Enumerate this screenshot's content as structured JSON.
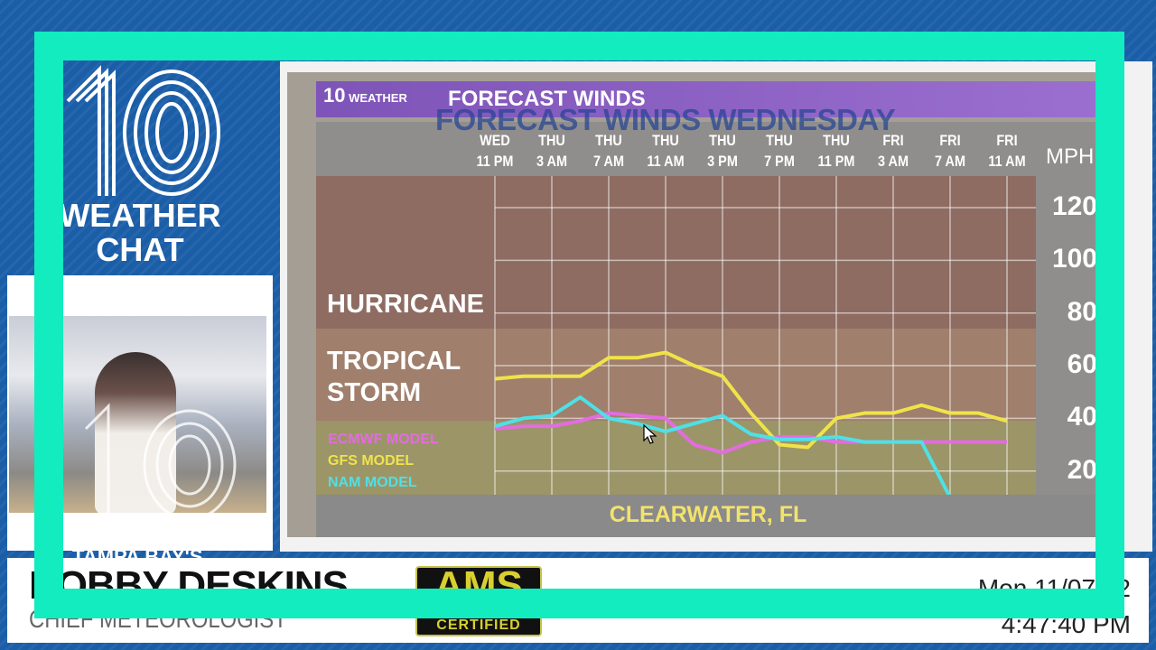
{
  "left": {
    "logo": "10",
    "title_line1": "WEATHER",
    "title_line2": "CHAT"
  },
  "graphic": {
    "brand": "WEATHER",
    "title": "FORECAST WINDS",
    "overlay_title": "FORECAST WINDS WEDNESDAY",
    "location": "CLEARWATER, FL",
    "categories": [
      "HURRICANE",
      "TROPICAL STORM"
    ],
    "category_label_lines": [
      [
        "HURRICANE"
      ],
      [
        "TROPICAL",
        "STORM"
      ]
    ]
  },
  "chart_data": {
    "type": "line",
    "title": "FORECAST WINDS",
    "ylabel": "MPH",
    "ylim": [
      11,
      132
    ],
    "yticks": [
      20,
      40,
      60,
      80,
      100,
      120
    ],
    "xtick_labels": [
      [
        "WED",
        "11 PM"
      ],
      [
        "THU",
        "3 AM"
      ],
      [
        "THU",
        "7 AM"
      ],
      [
        "THU",
        "11 AM"
      ],
      [
        "THU",
        "3 PM"
      ],
      [
        "THU",
        "7 PM"
      ],
      [
        "THU",
        "11 PM"
      ],
      [
        "FRI",
        "3 AM"
      ],
      [
        "FRI",
        "7 AM"
      ],
      [
        "FRI",
        "11 AM"
      ]
    ],
    "x": [
      "Wed 11 PM",
      "Thu 1 AM",
      "Thu 3 AM",
      "Thu 5 AM",
      "Thu 7 AM",
      "Thu 9 AM",
      "Thu 11 AM",
      "Thu 1 PM",
      "Thu 3 PM",
      "Thu 5 PM",
      "Thu 7 PM",
      "Thu 9 PM",
      "Thu 11 PM",
      "Fri 1 AM",
      "Fri 3 AM",
      "Fri 5 AM",
      "Fri 7 AM",
      "Fri 9 AM",
      "Fri 11 AM"
    ],
    "bands": [
      {
        "name": "HURRICANE",
        "from": 74,
        "to": 132,
        "color": "#8e6c62"
      },
      {
        "name": "TROPICAL STORM",
        "from": 39,
        "to": 74,
        "color": "#a07f6c"
      },
      {
        "name": "",
        "from": 11,
        "to": 39,
        "color": "#9c9568"
      }
    ],
    "grid": true,
    "legend": "bottom-left",
    "series": [
      {
        "name": "ECMWF MODEL",
        "color": "#e36ce0",
        "values": [
          36,
          37,
          37,
          39,
          42,
          41,
          40,
          30,
          27,
          31,
          33,
          33,
          31,
          31,
          31,
          31,
          31,
          31,
          31
        ]
      },
      {
        "name": "GFS MODEL",
        "color": "#f0e34a",
        "values": [
          55,
          56,
          56,
          56,
          63,
          63,
          65,
          60,
          56,
          42,
          30,
          29,
          40,
          42,
          42,
          45,
          42,
          42,
          39
        ]
      },
      {
        "name": "NAM MODEL",
        "color": "#4fe0e6",
        "values": [
          37,
          40,
          41,
          48,
          40,
          38,
          35,
          38,
          41,
          34,
          32,
          32,
          33,
          31,
          31,
          31,
          10,
          10,
          10
        ]
      }
    ]
  },
  "lower_third": {
    "station": "TAMPA BAY'S",
    "name": "BOBBY DESKINS",
    "role": "CHIEF METEOROLOGIST",
    "badge_top": "AMS",
    "badge_bottom": "CERTIFIED",
    "date": "Mon 11/07/22",
    "time": "4:47:40 PM"
  },
  "colors": {
    "frame": "#12ecbf",
    "background": "#1b5ea8",
    "title_bar": "#8a5fc4"
  }
}
